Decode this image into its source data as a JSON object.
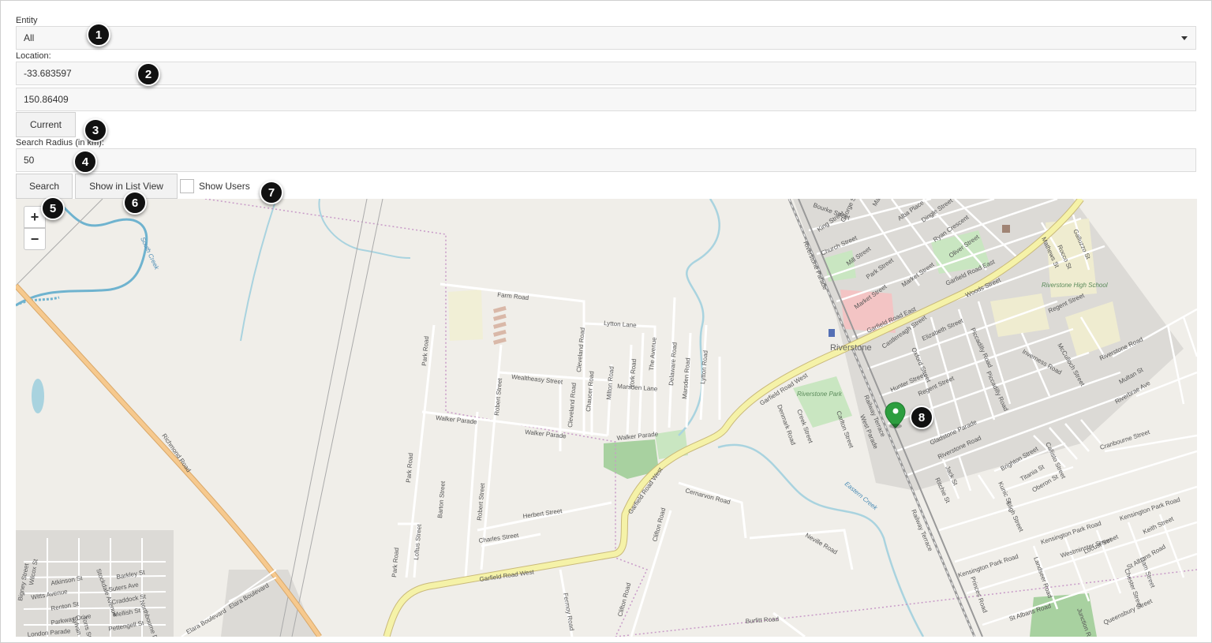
{
  "form": {
    "entity_label": "Entity",
    "entity_value": "All",
    "location_label": "Location:",
    "latitude": "-33.683597",
    "longitude": "150.86409",
    "current_button": "Current",
    "radius_label": "Search Radius (in km):",
    "radius_value": "50",
    "search_button": "Search",
    "list_view_button": "Show in List View",
    "show_users_label": "Show Users"
  },
  "badges": [
    "1",
    "2",
    "3",
    "4",
    "5",
    "6",
    "7",
    "8"
  ],
  "map": {
    "zoom_in": "+",
    "zoom_out": "−",
    "labels": {
      "richmond_road": "Richmond Road",
      "south_creek": "South Creek",
      "farm_road": "Farm Road",
      "lytton_lane": "Lytton Lane",
      "park_road": "Park Road",
      "park_road_2": "Park Road",
      "park_road_3": "Park Road",
      "wealtheasy_street": "Wealtheasy Street",
      "walker_parade": "Walker Parade",
      "walker_parade_2": "Walker Parade",
      "walker_parade_3": "Walker Parade",
      "marsden_lane": "Marsden Lane",
      "cleveland_road": "Cleveland Road",
      "cleveland_road_2": "Cleveland Road",
      "chaucer_road": "Chaucer Road",
      "milton_road": "Milton Road",
      "york_road": "York Road",
      "the_avenue": "The Avenue",
      "delaware_road": "Delaware Road",
      "marsden_road": "Marsden Road",
      "lytton_road": "Lytton Road",
      "robert_street": "Robert Street",
      "robert_street_2": "Robert Street",
      "robert_street_3": "Robert Street",
      "barton_street": "Barton Street",
      "loftus_street": "Loftus Street",
      "herbert_street": "Herbert Street",
      "charles_street": "Charles Street",
      "garfield_road_west": "Garfield Road West",
      "garfield_road_west_2": "Garfield Road West",
      "garfield_road_west_3": "Garfield Road West",
      "garfield_road_west_4": "Garfield Road West",
      "garfield_road_east": "Garfield Road East",
      "garfield_road_east_2": "Garfield Road East",
      "cernarvon_road": "Cernarvon Road",
      "clifton_road": "Clifton Road",
      "clifton_road_2": "Clifton Road",
      "fermoy_road": "Fermoy Road",
      "neville_road": "Neville Road",
      "burfitt_road": "Burfitt Road",
      "riverstone": "Riverstone",
      "riverstone_park": "Riverstone Park",
      "riverstone_high_school": "Riverstone High School",
      "denmark_road": "Denmark Road",
      "creek_street": "Creek Street",
      "carlton_street": "Carlton Street",
      "riverstone_parade": "Riverstone Parade",
      "railway_terrace": "Railway Terrace",
      "railway_terrace_2": "Railway Terrace",
      "west_parade": "West Parade",
      "eastern_creek": "Eastern Creek",
      "kensington_park_road": "Kensington Park Road",
      "kensington_park_road_2": "Kensington Park Road",
      "kensington_park_road_3": "Kensington Park Road",
      "westminster_street": "Westminster Street",
      "st_albans_road": "St Albans Road",
      "st_albans_road_2": "St Albans Road",
      "cranbourne_street": "Cranbourne Street",
      "regent_street": "Regent Street",
      "regent_street_2": "Regent Street",
      "gladstone_parade": "Gladstone Parade",
      "riverstone_road": "Riverstone Road",
      "riverstone_road_2": "Riverstone Road",
      "hunter_street": "Hunter Street",
      "elizabeth_street": "Elizabeth Street",
      "piccadilly_road": "Piccadilly Road",
      "piccadilly_road_2": "Piccadilly Road",
      "woods_street": "Woods Street",
      "castlereagh_street": "Castlereagh Street",
      "oxford_street": "Oxford Street",
      "church_street": "Church Street",
      "mill_street": "Mill Street",
      "park_street": "Park Street",
      "market_street": "Market Street",
      "market_street_2": "Market Street",
      "king_street": "King Street",
      "george_street": "George Street",
      "oliver_street": "Oliver Street",
      "ryan_crescent": "Ryan Crescent",
      "dingle_street": "Dingle Street",
      "alba_place": "Alba Place",
      "mathews_st": "Mathews St",
      "galluzzo_st": "Galluzzo St",
      "rocco_st": "Rocco St",
      "mcculloch_street": "McCulloch Street",
      "inverness_road": "Inverness Road",
      "multan_st": "Multan St",
      "riverbrae_ave": "Riverbrae Ave",
      "brighton_street": "Brighton Street",
      "titania_st": "Titania St",
      "oberon_st": "Oberon St",
      "bligh_street": "Bligh Street",
      "kunic_st": "Kunic St",
      "jack_st": "Jack St",
      "ritchie_st": "Ritchie St",
      "callisto_street": "Callisto Street",
      "locust_street": "Locust Street",
      "keith_street": "Keith Street",
      "landseer_road": "Landseer Road",
      "princes_road": "Princes Road",
      "queensbury_street": "Queensbury Street",
      "chester_street": "Chester Street",
      "liam_street": "Liam Street",
      "junction_road": "Junction Road",
      "elara_boulevard": "Elara Boulevard",
      "elara_boulevard_2": "Elara Boulevard",
      "atkinson_st": "Atkinson St",
      "barkley_st": "Barkley St",
      "witts_avenue": "Witts Avenue",
      "suters_ave": "Suters Ave",
      "craddock_st": "Craddock St",
      "mellish_st": "Mellish St",
      "pettengell_st": "Pettengell St",
      "renton_st": "Renton St",
      "parkway_drive": "Parkway Drive",
      "northbourne_drive": "Northbourne Drive",
      "london_parade": "London Parade",
      "wilcox_st": "Wilcox St",
      "bigney_street": "Bigney Street",
      "sylvan_st": "Sylvan St",
      "torrs_st": "Torrs St",
      "stockdale_avenue": "Stockdale Avenue",
      "bourke_street": "Bourke Street",
      "macquarie_street": "Macquarie Street"
    }
  },
  "colors": {
    "map_bg": "#f0eee9",
    "road_major": "#f6c98e",
    "road_secondary": "#f5f2a8",
    "water": "#a9d3df",
    "park": "#c9e6c1",
    "marker": "#2d9e3f",
    "badge": "#111111"
  }
}
